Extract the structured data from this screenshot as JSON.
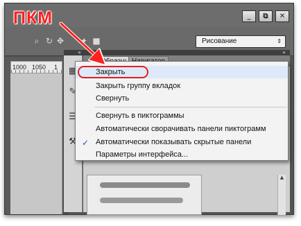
{
  "annotation": {
    "label": "ПКМ",
    "color": "#ff2020"
  },
  "window": {
    "minimize_label": "_",
    "restore_label": "⧉",
    "close_label": "✕"
  },
  "options_bar": {
    "workspace_value": "Рисование",
    "workspace_arrow": "⇕"
  },
  "ruler": {
    "ticks": [
      "1000",
      "1050",
      "1"
    ]
  },
  "dock": {
    "collapse_left": "«",
    "collapse_right": "»"
  },
  "panel": {
    "tabs": [
      {
        "label": "Образцы"
      },
      {
        "label": "Навигатор"
      }
    ],
    "scroll_up": "▲"
  },
  "context_menu": {
    "items": [
      {
        "label": "Закрыть",
        "highlighted": true
      },
      {
        "label": "Закрыть группу вкладок"
      },
      {
        "label": "Свернуть"
      },
      {
        "label": "Свернуть в пиктограммы"
      },
      {
        "label": "Автоматически сворачивать панели пиктограмм"
      },
      {
        "label": "Автоматически показывать скрытые панели",
        "checked": true
      },
      {
        "label": "Параметры интерфейса..."
      }
    ],
    "check_mark": "✓"
  },
  "colors": {
    "accent_red": "#e02020",
    "menu_hover": "#dde9f8",
    "check_blue": "#1f53b5"
  }
}
